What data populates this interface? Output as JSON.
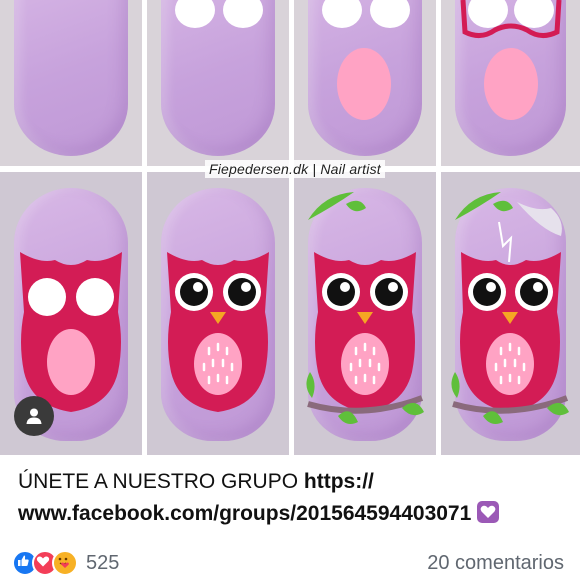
{
  "photo": {
    "watermark": "Fiepedersen.dk | Nail artist"
  },
  "post": {
    "caption_text": "ÚNETE A NUESTRO GRUPO ",
    "caption_link": "https:// www.facebook.com/groups/201564594403071"
  },
  "footer": {
    "reaction_count": "525",
    "comments_label": "20 comentarios"
  },
  "colors": {
    "nail": "#c9a6dd",
    "owl": "#d31c55",
    "belly": "#ffa3c4",
    "leaf": "#5fbf3a"
  },
  "icons": [
    "person-icon",
    "like-reaction-icon",
    "love-reaction-icon",
    "care-reaction-icon",
    "purple-heart-emoji-icon"
  ]
}
